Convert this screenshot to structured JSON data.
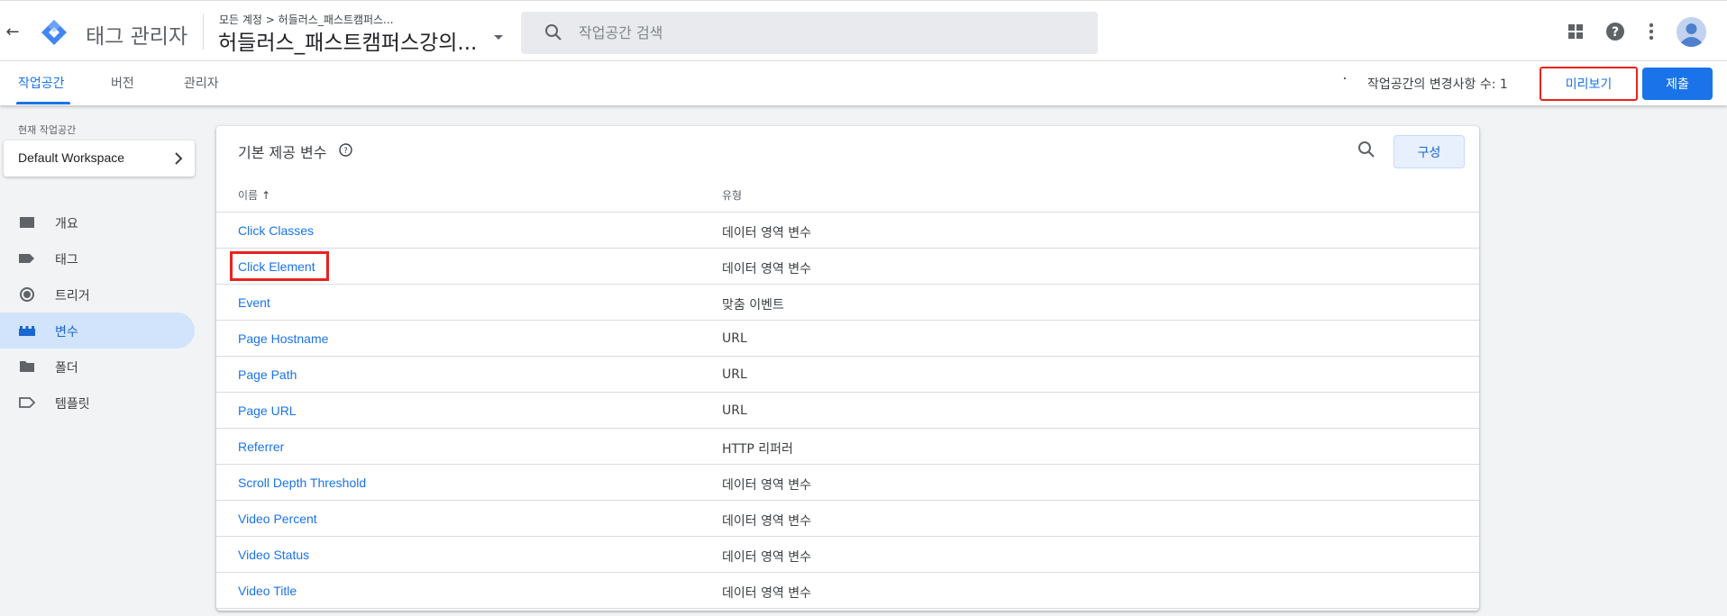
{
  "header": {
    "back_label": "←",
    "app_title": "태그 관리자",
    "account_crumb": "모든 계정 > 허들러스_패스트캠퍼스...",
    "container_name": "허들러스_패스트캠퍼스강의...",
    "search_placeholder": "작업공간 검색",
    "icons": [
      "apps-grid-icon",
      "help-icon",
      "more-vert-icon",
      "account-avatar"
    ]
  },
  "nav": {
    "tabs": [
      {
        "label": "작업공간",
        "active": true
      },
      {
        "label": "버전",
        "active": false
      },
      {
        "label": "관리자",
        "active": false
      }
    ],
    "changes_text": "작업공간의 변경사항 수: 1",
    "preview_label": "미리보기",
    "submit_label": "제출"
  },
  "sidebar": {
    "workspace_label": "현재 작업공간",
    "workspace_name": "Default Workspace",
    "items": [
      {
        "label": "개요",
        "icon": "overview-icon",
        "active": false
      },
      {
        "label": "태그",
        "icon": "tag-icon",
        "active": false
      },
      {
        "label": "트리거",
        "icon": "trigger-icon",
        "active": false
      },
      {
        "label": "변수",
        "icon": "variables-icon",
        "active": true
      },
      {
        "label": "폴더",
        "icon": "folder-icon",
        "active": false
      },
      {
        "label": "템플릿",
        "icon": "template-icon",
        "active": false
      }
    ]
  },
  "main": {
    "card_title": "기본 제공 변수",
    "config_label": "구성",
    "columns": {
      "name": "이름",
      "type": "유형"
    },
    "rows": [
      {
        "name": "Click Classes",
        "type": "데이터 영역 변수"
      },
      {
        "name": "Click Element",
        "type": "데이터 영역 변수"
      },
      {
        "name": "Event",
        "type": "맞춤 이벤트"
      },
      {
        "name": "Page Hostname",
        "type": "URL"
      },
      {
        "name": "Page Path",
        "type": "URL"
      },
      {
        "name": "Page URL",
        "type": "URL"
      },
      {
        "name": "Referrer",
        "type": "HTTP 리퍼러"
      },
      {
        "name": "Scroll Depth Threshold",
        "type": "데이터 영역 변수"
      },
      {
        "name": "Video Percent",
        "type": "데이터 영역 변수"
      },
      {
        "name": "Video Status",
        "type": "데이터 영역 변수"
      },
      {
        "name": "Video Title",
        "type": "데이터 영역 변수"
      }
    ]
  },
  "colors": {
    "accent": "#1a73e8",
    "highlight_red": "#e8231f",
    "active_nav_bg": "#d2e3fc"
  }
}
